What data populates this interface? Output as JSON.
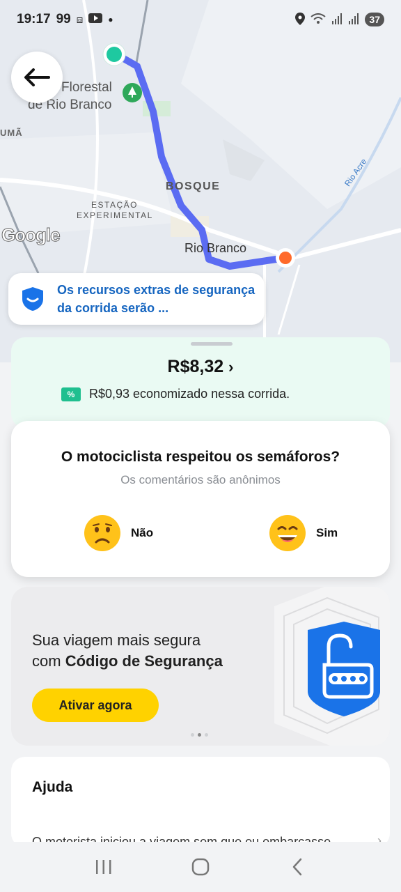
{
  "status_bar": {
    "time": "19:17",
    "extra": "99",
    "battery": "37",
    "icons": [
      "location-icon",
      "wifi-icon",
      "signal-icon",
      "signal-icon"
    ]
  },
  "map": {
    "labels": {
      "florestal": "Florestal",
      "de_rio_branco": "de Rio Branco",
      "uma": "UMÃ",
      "bosque": "BOSQUE",
      "estacao": "ESTAÇÃO",
      "experimental": "EXPERIMENTAL",
      "rio_branco": "Rio Branco",
      "rio_acre": "Rio Acre"
    },
    "google": "Google",
    "route_color": "#5b6cf2",
    "origin_color": "#1ec9a0",
    "destination_color": "#ff6a2b"
  },
  "safety_banner": {
    "text": "Os recursos extras de segurança da corrida serão ..."
  },
  "price_card": {
    "price": "R$8,32",
    "savings_icon": "%",
    "savings": "R$0,93 economizado nessa corrida."
  },
  "rating": {
    "question": "O motociclista respeitou os semáforos?",
    "subtitle": "Os comentários são anônimos",
    "option_no": "Não",
    "option_yes": "Sim"
  },
  "promo": {
    "line1": "Sua viagem mais segura",
    "line2_prefix": "com ",
    "line2_bold": "Código de Segurança",
    "button": "Ativar agora"
  },
  "help": {
    "title": "Ajuda",
    "item": "O motorista iniciou a viagem sem que eu embarcasse"
  },
  "colors": {
    "accent_yellow": "#ffd200",
    "link_blue": "#1565c0",
    "price_card_bg": "#eafaf3"
  }
}
